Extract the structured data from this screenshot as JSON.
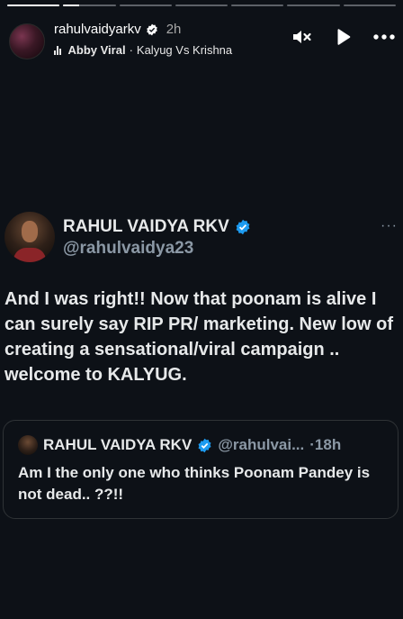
{
  "story": {
    "progress_segments": [
      1,
      0.3,
      0,
      0,
      0,
      0,
      0
    ],
    "username": "rahulvaidyarkv",
    "time": "2h",
    "music_artist": "Abby Viral",
    "music_separator": "·",
    "music_title": "Kalyug Vs Krishna",
    "controls": [
      "mute-icon",
      "play-icon",
      "more-options-icon"
    ]
  },
  "tweet": {
    "display_name": "RAHUL VAIDYA RKV",
    "handle": "@rahulvaidya23",
    "more": "···",
    "text": "And I was right!! Now that poonam is alive I can surely say RIP PR/ marketing. New low of creating a sensational/viral campaign .. welcome to KALYUG."
  },
  "quoted_tweet": {
    "display_name": "RAHUL VAIDYA RKV",
    "handle": "@rahulvai...",
    "time": "·18h",
    "text": "Am I the only one who thinks Poonam Pandey is not dead.. ??!!"
  },
  "colors": {
    "background": "#0d1117",
    "verified_blue": "#1d9bf0",
    "secondary_text": "#8b98a5"
  }
}
